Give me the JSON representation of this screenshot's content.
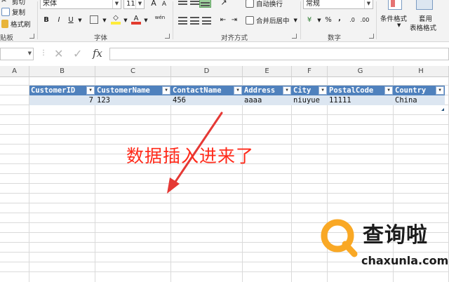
{
  "ribbon": {
    "clipboard": {
      "cut_label": "剪切",
      "copy_label": "复制",
      "format_painter_label": "格式刷",
      "group_label": "贴板"
    },
    "font": {
      "font_name": "宋体",
      "font_size": "11",
      "group_label": "字体",
      "bold": "B",
      "italic": "I",
      "underline": "U",
      "grow": "A",
      "shrink": "A",
      "font_color": "A",
      "phonetic": "wén"
    },
    "alignment": {
      "wrap_text_label": "自动换行",
      "merge_center_label": "合并后居中",
      "group_label": "对齐方式"
    },
    "number": {
      "format_value": "常规",
      "percent": "%",
      "comma": ",",
      "group_label": "数字"
    },
    "styles": {
      "conditional_format_label": "条件格式",
      "table_format_line1": "套用",
      "table_format_line2": "表格格式"
    },
    "colors": {
      "fill_yellow": "#ffeb3b",
      "font_red": "#e23b2e",
      "accent_green": "#2e7d32"
    }
  },
  "formula_bar": {
    "name_box_value": "",
    "fx_label": "fx",
    "cancel_symbol": "✕",
    "enter_symbol": "✓",
    "formula_value": ""
  },
  "grid": {
    "column_letters": [
      "A",
      "B",
      "C",
      "D",
      "E",
      "F",
      "G",
      "H"
    ],
    "table": {
      "headers": [
        "CustomerID",
        "CustomerName",
        "ContactName",
        "Address",
        "City",
        "PostalCode",
        "Country"
      ],
      "rows": [
        [
          "7",
          "123",
          "456",
          "aaaa",
          "niuyue",
          "11111",
          "China"
        ]
      ],
      "header_color": "#4f81bd",
      "row_color": "#dce6f1"
    }
  },
  "annotation": {
    "caption": "数据插入进来了",
    "arrow_color": "#e53935"
  },
  "watermark": {
    "text": "查询啦",
    "url": "chaxunla.com",
    "logo_color": "#f9a825"
  }
}
